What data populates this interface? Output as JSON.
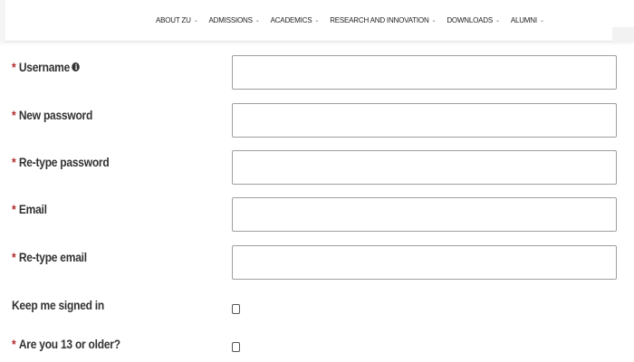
{
  "nav": {
    "items": [
      {
        "label": "ABOUT ZU"
      },
      {
        "label": "ADMISSIONS"
      },
      {
        "label": "ACADEMICS"
      },
      {
        "label": "RESEARCH AND INNOVATION"
      },
      {
        "label": "DOWNLOADS"
      },
      {
        "label": "ALUMNI"
      }
    ],
    "caret": "⌄"
  },
  "form": {
    "required_mark": "*",
    "username_label": "Username",
    "username_value": "",
    "new_password_label": "New password",
    "new_password_value": "",
    "retype_password_label": "Re-type password",
    "retype_password_value": "",
    "email_label": "Email",
    "email_value": "",
    "retype_email_label": "Re-type email",
    "retype_email_value": "",
    "keep_signed_in_label": "Keep me signed in",
    "keep_signed_in_checked": false,
    "age_label": "Are you 13 or older?",
    "age_checked": false
  },
  "colors": {
    "required": "#b32b2b",
    "label": "#333333",
    "field_border": "#9e9e9e"
  },
  "icons": {
    "info": "info-icon"
  }
}
